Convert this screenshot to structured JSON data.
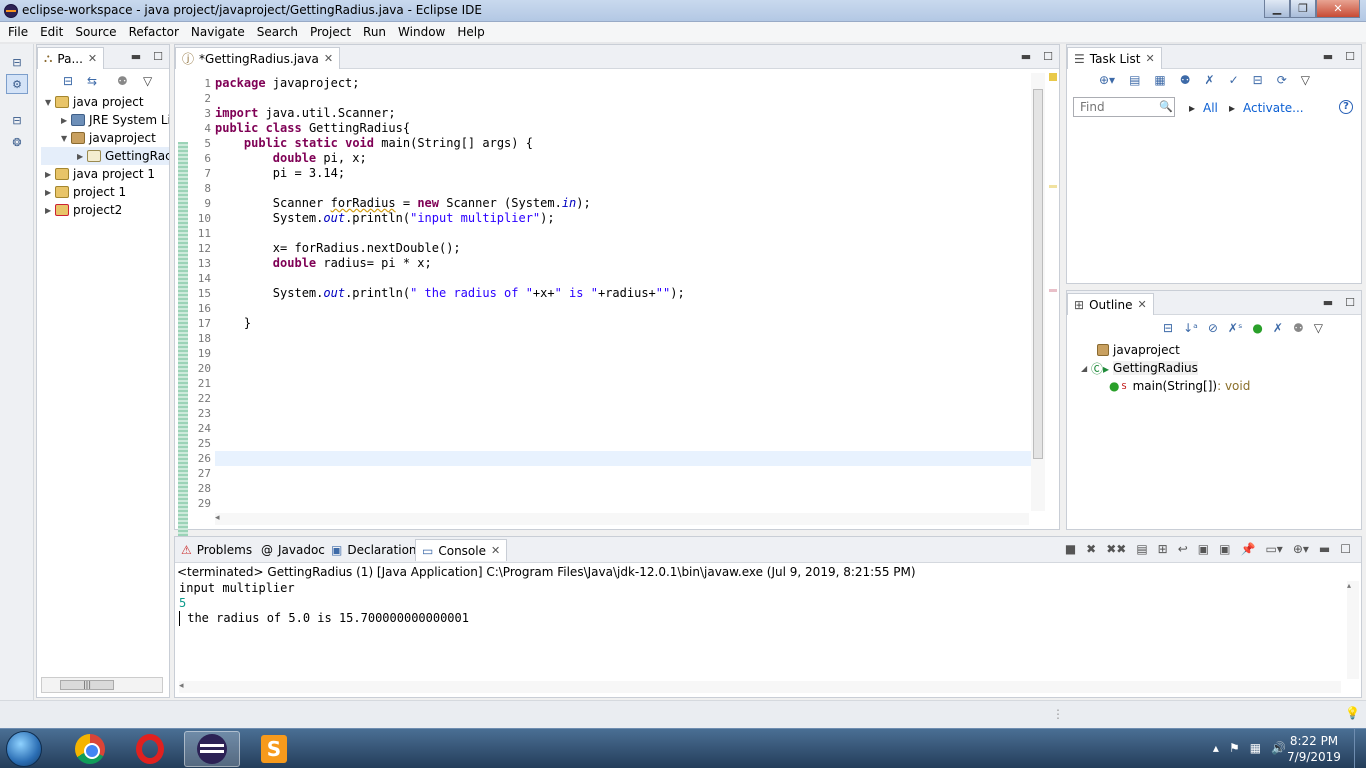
{
  "window": {
    "title": "eclipse-workspace - java project/javaproject/GettingRadius.java - Eclipse IDE"
  },
  "menu": [
    "File",
    "Edit",
    "Source",
    "Refactor",
    "Navigate",
    "Search",
    "Project",
    "Run",
    "Window",
    "Help"
  ],
  "package_explorer": {
    "tab_label": "Pa...",
    "tree": [
      {
        "label": "java project",
        "twist": "▼",
        "icon": "project-icon",
        "indent": 0
      },
      {
        "label": "JRE System Lib",
        "twist": "▶",
        "icon": "jre-library-icon",
        "indent": 1
      },
      {
        "label": "javaproject",
        "twist": "▼",
        "icon": "package-icon",
        "indent": 1
      },
      {
        "label": "GettingRac",
        "twist": "▶",
        "icon": "java-file-icon",
        "indent": 2
      },
      {
        "label": "java project 1",
        "twist": "▶",
        "icon": "project-icon",
        "indent": 0
      },
      {
        "label": "project 1",
        "twist": "▶",
        "icon": "project-icon",
        "indent": 0
      },
      {
        "label": "project2",
        "twist": "▶",
        "icon": "project-error-icon",
        "indent": 0
      }
    ]
  },
  "editor": {
    "tab_label": "*GettingRadius.java",
    "line_count": 29,
    "last_line_partial": "}",
    "highlighted_line": 26,
    "code": [
      "package javaproject;",
      "",
      "import java.util.Scanner;",
      "public class GettingRadius{",
      "    public static void main(String[] args) {",
      "        double pi, x;",
      "        pi = 3.14;",
      "",
      "        Scanner forRadius = new Scanner (System.in);",
      "        System.out.println(\"input multiplier\");",
      "",
      "        x= forRadius.nextDouble();",
      "        double radius= pi * x;",
      "",
      "        System.out.println(\" the radius of \"+x+\" is \"+radius+\"\");",
      "",
      "    }",
      "",
      "",
      "",
      "",
      "",
      "",
      "",
      "",
      "",
      "",
      "",
      ""
    ]
  },
  "task_list": {
    "tab_label": "Task List",
    "find_placeholder": "Find",
    "all_label": "All",
    "activate_label": "Activate...",
    "help_label": "?"
  },
  "outline": {
    "tab_label": "Outline",
    "items": [
      {
        "label": "javaproject",
        "suffix": ""
      },
      {
        "label": "GettingRadius",
        "suffix": ""
      },
      {
        "label": "main(String[])",
        "suffix": " : void"
      }
    ],
    "static_mark": "S"
  },
  "console": {
    "tabs": [
      "Problems",
      "Javadoc",
      "Declaration",
      "Console"
    ],
    "tab_prefixes": [
      "",
      "@ ",
      "",
      ""
    ],
    "terminated": "<terminated> GettingRadius (1) [Java Application] C:\\Program Files\\Java\\jdk-12.0.1\\bin\\javaw.exe (Jul 9, 2019, 8:21:55 PM)",
    "lines": [
      "input multiplier",
      "5",
      " the radius of 5.0 is 15.700000000000001"
    ]
  },
  "taskbar": {
    "time": "8:22 PM",
    "date": "7/9/2019"
  }
}
